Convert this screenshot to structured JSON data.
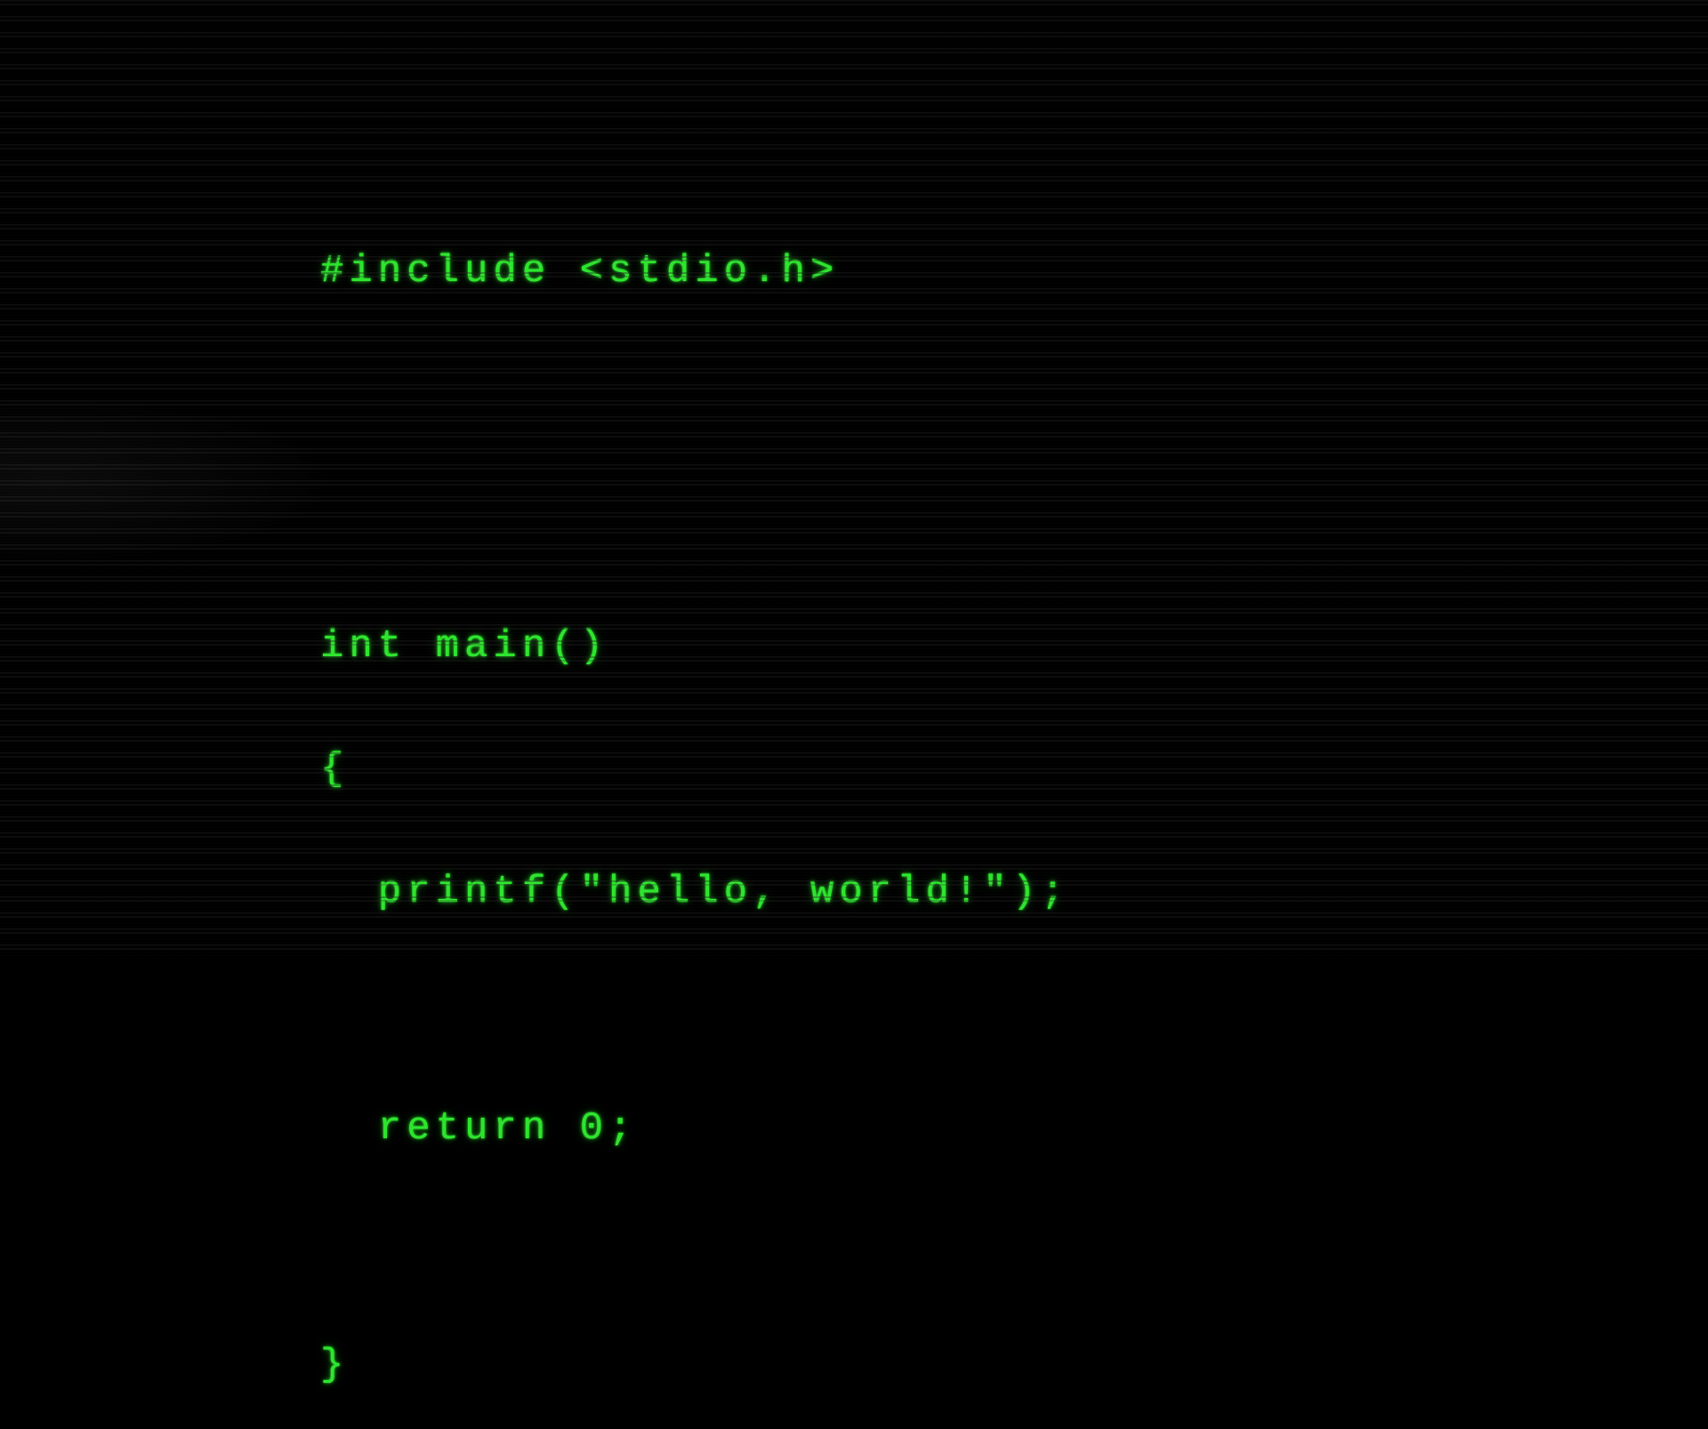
{
  "terminal": {
    "colors": {
      "foreground": "#2ee52e",
      "background": "#000000"
    },
    "code": {
      "line1": "#include <stdio.h>",
      "line2": "int main()",
      "line3": "{",
      "line4": "  printf(\"hello, world!\");",
      "line5": "  return 0;",
      "line6": "}"
    }
  }
}
